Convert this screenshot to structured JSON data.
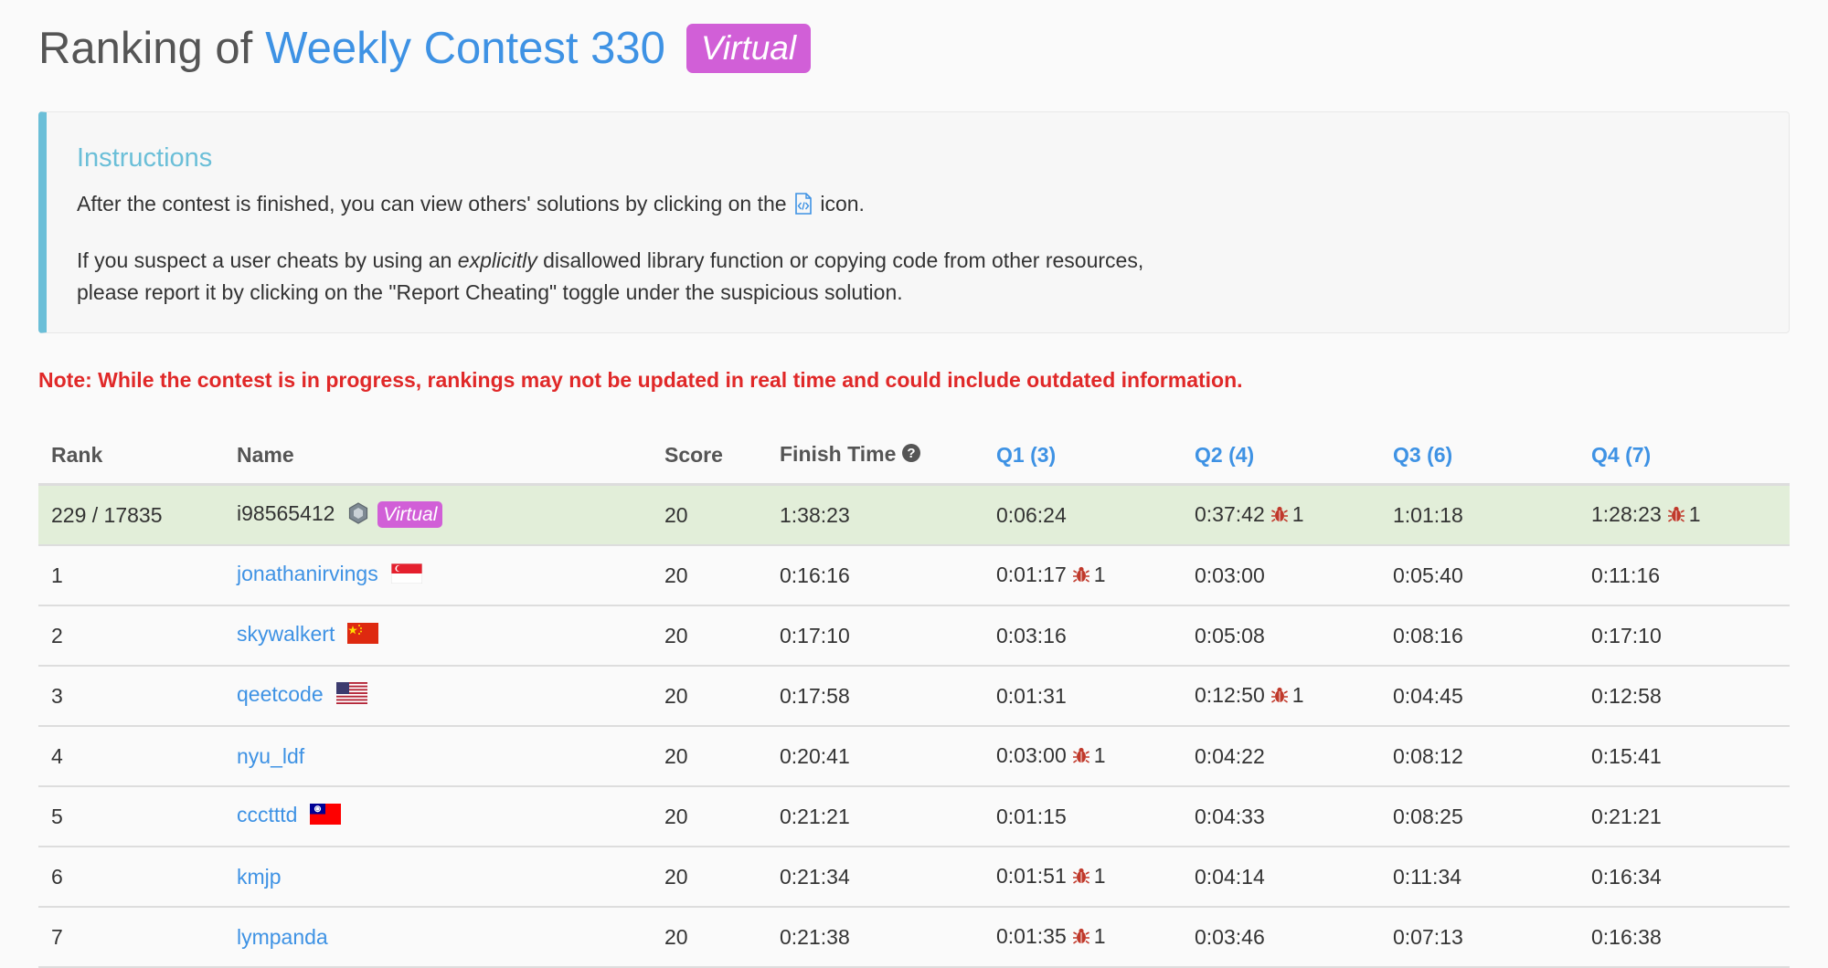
{
  "header": {
    "prefix": "Ranking of",
    "contest_name": "Weekly Contest 330",
    "badge": "Virtual"
  },
  "instructions": {
    "title": "Instructions",
    "line1_before": "After the contest is finished, you can view others' solutions by clicking on the",
    "line1_after": "icon.",
    "line2_before": "If you suspect a user cheats by using an",
    "line2_em": "explicitly",
    "line2_after": "disallowed library function or copying code from other resources,",
    "line3": "please report it by clicking on the \"Report Cheating\" toggle under the suspicious solution."
  },
  "note": "Note: While the contest is in progress, rankings may not be updated in real time and could include outdated information.",
  "table": {
    "headers": {
      "rank": "Rank",
      "name": "Name",
      "score": "Score",
      "finish": "Finish Time",
      "q1": "Q1 (3)",
      "q2": "Q2 (4)",
      "q3": "Q3 (6)",
      "q4": "Q4 (7)"
    },
    "my_row": {
      "rank": "229 / 17835",
      "name": "i98565412",
      "badge": "Virtual",
      "score": "20",
      "finish": "1:38:23",
      "q1": "0:06:24",
      "q2": "0:37:42",
      "q2_bugs": "1",
      "q3": "1:01:18",
      "q4": "1:28:23",
      "q4_bugs": "1"
    },
    "rows": [
      {
        "rank": "1",
        "name": "jonathanirvings",
        "flag": "singapore-flag",
        "score": "20",
        "finish": "0:16:16",
        "q1": "0:01:17",
        "q1_bugs": "1",
        "q2": "0:03:00",
        "q3": "0:05:40",
        "q4": "0:11:16"
      },
      {
        "rank": "2",
        "name": "skywalkert",
        "flag": "china-flag",
        "score": "20",
        "finish": "0:17:10",
        "q1": "0:03:16",
        "q2": "0:05:08",
        "q3": "0:08:16",
        "q4": "0:17:10"
      },
      {
        "rank": "3",
        "name": "qeetcode",
        "flag": "usa-flag",
        "score": "20",
        "finish": "0:17:58",
        "q1": "0:01:31",
        "q2": "0:12:50",
        "q2_bugs": "1",
        "q3": "0:04:45",
        "q4": "0:12:58"
      },
      {
        "rank": "4",
        "name": "nyu_ldf",
        "score": "20",
        "finish": "0:20:41",
        "q1": "0:03:00",
        "q1_bugs": "1",
        "q2": "0:04:22",
        "q3": "0:08:12",
        "q4": "0:15:41"
      },
      {
        "rank": "5",
        "name": "ccctttd",
        "flag": "taiwan-flag",
        "score": "20",
        "finish": "0:21:21",
        "q1": "0:01:15",
        "q2": "0:04:33",
        "q3": "0:08:25",
        "q4": "0:21:21"
      },
      {
        "rank": "6",
        "name": "kmjp",
        "score": "20",
        "finish": "0:21:34",
        "q1": "0:01:51",
        "q1_bugs": "1",
        "q2": "0:04:14",
        "q3": "0:11:34",
        "q4": "0:16:34"
      },
      {
        "rank": "7",
        "name": "lympanda",
        "score": "20",
        "finish": "0:21:38",
        "q1": "0:01:35",
        "q1_bugs": "1",
        "q2": "0:03:46",
        "q3": "0:07:13",
        "q4": "0:16:38"
      }
    ]
  },
  "colors": {
    "accent": "#3e92e4",
    "virtual": "#d15fd7",
    "note": "#e02828",
    "highlight_row": "#e2eed9",
    "bug": "#c0392b"
  }
}
